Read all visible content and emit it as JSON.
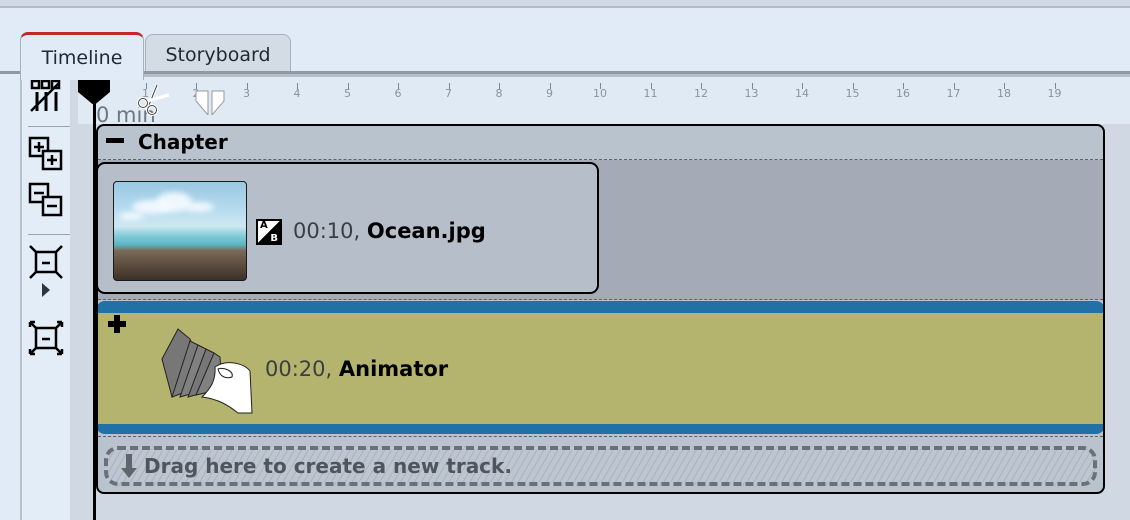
{
  "tabs": [
    {
      "label": "Timeline",
      "active": true
    },
    {
      "label": "Storyboard",
      "active": false
    }
  ],
  "toolbar": {
    "items": [
      {
        "name": "disable-tracks-icon"
      },
      {
        "name": "expand-all-icon"
      },
      {
        "name": "collapse-all-icon"
      },
      {
        "name": "zoom-to-fit-icon"
      },
      {
        "name": "expand-arrow-icon"
      },
      {
        "name": "zoom-out-icon"
      }
    ]
  },
  "ruler": {
    "start_label": "0 min",
    "ticks": [
      "1",
      "2",
      "3",
      "4",
      "5",
      "6",
      "7",
      "8",
      "9",
      "10",
      "11",
      "12",
      "13",
      "14",
      "15",
      "16",
      "17",
      "18",
      "19"
    ]
  },
  "chapter": {
    "title": "Chapter",
    "clips": [
      {
        "duration": "00:10,",
        "name": "Ocean.jpg",
        "type": "image"
      },
      {
        "duration": "00:20,",
        "name": "Animator",
        "type": "animator"
      }
    ]
  },
  "dropzone": {
    "text": "Drag here to create a new track."
  },
  "colors": {
    "active_tab_accent": "#c0282a",
    "animator_clip": "#b4b46e",
    "animator_band": "#2170a6"
  }
}
